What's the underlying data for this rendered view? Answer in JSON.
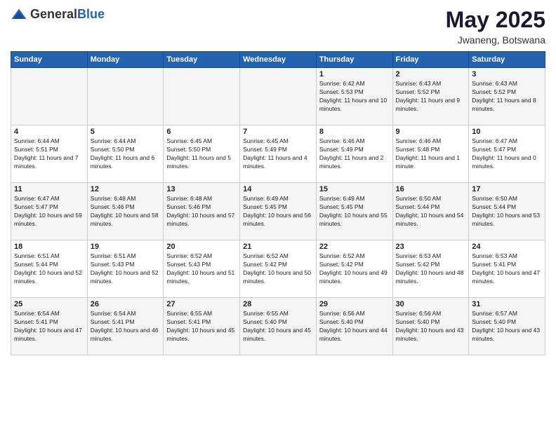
{
  "header": {
    "logo_general": "General",
    "logo_blue": "Blue",
    "month": "May 2025",
    "location": "Jwaneng, Botswana"
  },
  "weekdays": [
    "Sunday",
    "Monday",
    "Tuesday",
    "Wednesday",
    "Thursday",
    "Friday",
    "Saturday"
  ],
  "weeks": [
    [
      {
        "day": "",
        "info": ""
      },
      {
        "day": "",
        "info": ""
      },
      {
        "day": "",
        "info": ""
      },
      {
        "day": "",
        "info": ""
      },
      {
        "day": "1",
        "info": "Sunrise: 6:42 AM\nSunset: 5:53 PM\nDaylight: 11 hours and 10 minutes."
      },
      {
        "day": "2",
        "info": "Sunrise: 6:43 AM\nSunset: 5:52 PM\nDaylight: 11 hours and 9 minutes."
      },
      {
        "day": "3",
        "info": "Sunrise: 6:43 AM\nSunset: 5:52 PM\nDaylight: 11 hours and 8 minutes."
      }
    ],
    [
      {
        "day": "4",
        "info": "Sunrise: 6:44 AM\nSunset: 5:51 PM\nDaylight: 11 hours and 7 minutes."
      },
      {
        "day": "5",
        "info": "Sunrise: 6:44 AM\nSunset: 5:50 PM\nDaylight: 11 hours and 6 minutes."
      },
      {
        "day": "6",
        "info": "Sunrise: 6:45 AM\nSunset: 5:50 PM\nDaylight: 11 hours and 5 minutes."
      },
      {
        "day": "7",
        "info": "Sunrise: 6:45 AM\nSunset: 5:49 PM\nDaylight: 11 hours and 4 minutes."
      },
      {
        "day": "8",
        "info": "Sunrise: 6:46 AM\nSunset: 5:49 PM\nDaylight: 11 hours and 2 minutes."
      },
      {
        "day": "9",
        "info": "Sunrise: 6:46 AM\nSunset: 5:48 PM\nDaylight: 11 hours and 1 minute."
      },
      {
        "day": "10",
        "info": "Sunrise: 6:47 AM\nSunset: 5:47 PM\nDaylight: 11 hours and 0 minutes."
      }
    ],
    [
      {
        "day": "11",
        "info": "Sunrise: 6:47 AM\nSunset: 5:47 PM\nDaylight: 10 hours and 59 minutes."
      },
      {
        "day": "12",
        "info": "Sunrise: 6:48 AM\nSunset: 5:46 PM\nDaylight: 10 hours and 58 minutes."
      },
      {
        "day": "13",
        "info": "Sunrise: 6:48 AM\nSunset: 5:46 PM\nDaylight: 10 hours and 57 minutes."
      },
      {
        "day": "14",
        "info": "Sunrise: 6:49 AM\nSunset: 5:45 PM\nDaylight: 10 hours and 56 minutes."
      },
      {
        "day": "15",
        "info": "Sunrise: 6:49 AM\nSunset: 5:45 PM\nDaylight: 10 hours and 55 minutes."
      },
      {
        "day": "16",
        "info": "Sunrise: 6:50 AM\nSunset: 5:44 PM\nDaylight: 10 hours and 54 minutes."
      },
      {
        "day": "17",
        "info": "Sunrise: 6:50 AM\nSunset: 5:44 PM\nDaylight: 10 hours and 53 minutes."
      }
    ],
    [
      {
        "day": "18",
        "info": "Sunrise: 6:51 AM\nSunset: 5:44 PM\nDaylight: 10 hours and 52 minutes."
      },
      {
        "day": "19",
        "info": "Sunrise: 6:51 AM\nSunset: 5:43 PM\nDaylight: 10 hours and 52 minutes."
      },
      {
        "day": "20",
        "info": "Sunrise: 6:52 AM\nSunset: 5:43 PM\nDaylight: 10 hours and 51 minutes."
      },
      {
        "day": "21",
        "info": "Sunrise: 6:52 AM\nSunset: 5:42 PM\nDaylight: 10 hours and 50 minutes."
      },
      {
        "day": "22",
        "info": "Sunrise: 6:52 AM\nSunset: 5:42 PM\nDaylight: 10 hours and 49 minutes."
      },
      {
        "day": "23",
        "info": "Sunrise: 6:53 AM\nSunset: 5:42 PM\nDaylight: 10 hours and 48 minutes."
      },
      {
        "day": "24",
        "info": "Sunrise: 6:53 AM\nSunset: 5:41 PM\nDaylight: 10 hours and 47 minutes."
      }
    ],
    [
      {
        "day": "25",
        "info": "Sunrise: 6:54 AM\nSunset: 5:41 PM\nDaylight: 10 hours and 47 minutes."
      },
      {
        "day": "26",
        "info": "Sunrise: 6:54 AM\nSunset: 5:41 PM\nDaylight: 10 hours and 46 minutes."
      },
      {
        "day": "27",
        "info": "Sunrise: 6:55 AM\nSunset: 5:41 PM\nDaylight: 10 hours and 45 minutes."
      },
      {
        "day": "28",
        "info": "Sunrise: 6:55 AM\nSunset: 5:40 PM\nDaylight: 10 hours and 45 minutes."
      },
      {
        "day": "29",
        "info": "Sunrise: 6:56 AM\nSunset: 5:40 PM\nDaylight: 10 hours and 44 minutes."
      },
      {
        "day": "30",
        "info": "Sunrise: 6:56 AM\nSunset: 5:40 PM\nDaylight: 10 hours and 43 minutes."
      },
      {
        "day": "31",
        "info": "Sunrise: 6:57 AM\nSunset: 5:40 PM\nDaylight: 10 hours and 43 minutes."
      }
    ]
  ]
}
